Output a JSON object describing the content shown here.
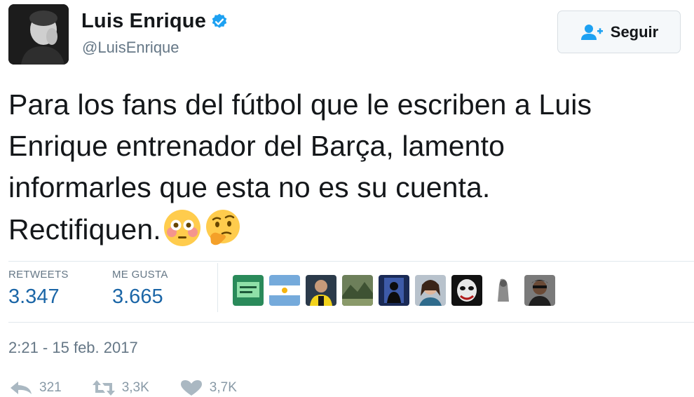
{
  "header": {
    "display_name": "Luis Enrique",
    "handle": "@LuisEnrique",
    "follow_label": "Seguir"
  },
  "tweet": {
    "lines": [
      "Para los fans del fútbol que le escriben a Luis",
      "Enrique entrenador del Barça, lamento",
      "informarles que esta no es su cuenta.",
      "Rectifiquen."
    ],
    "emojis": [
      "flushed-face-icon",
      "thinking-face-icon"
    ]
  },
  "stats": {
    "retweets_label": "RETWEETS",
    "retweets_value": "3.347",
    "likes_label": "ME GUSTA",
    "likes_value": "3.665"
  },
  "likers_count": 9,
  "timestamp": "2:21 - 15 feb. 2017",
  "actions": {
    "reply_count": "321",
    "retweet_count": "3,3K",
    "like_count": "3,7K"
  },
  "colors": {
    "verified": "#1da1f2",
    "stat_value": "#1b66a7",
    "secondary_text": "#657786"
  }
}
